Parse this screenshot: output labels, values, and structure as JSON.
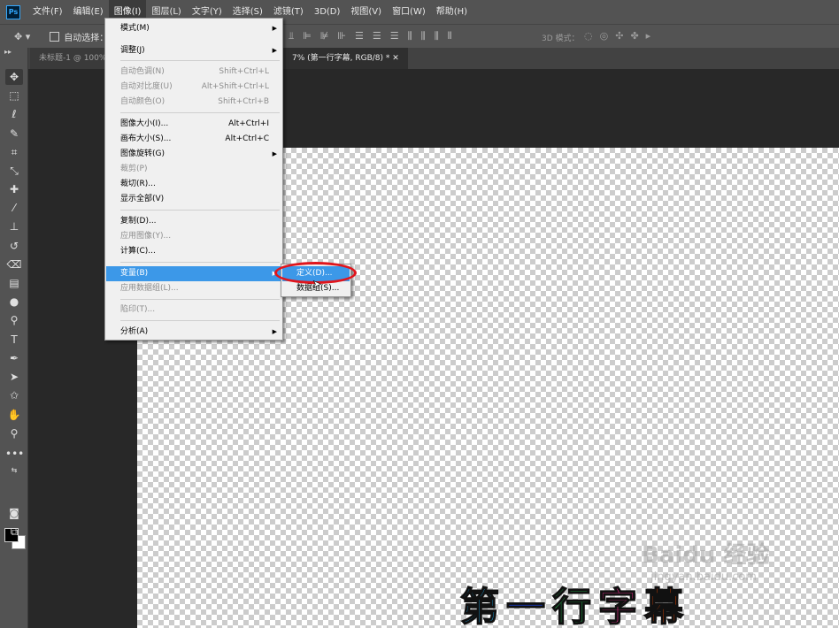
{
  "menubar": {
    "logo": "Ps",
    "items": [
      "文件(F)",
      "编辑(E)",
      "图像(I)",
      "图层(L)",
      "文字(Y)",
      "选择(S)",
      "滤镜(T)",
      "3D(D)",
      "视图(V)",
      "窗口(W)",
      "帮助(H)"
    ],
    "active_index": 2
  },
  "options": {
    "move_icon": "move-icon",
    "auto_select_label": "自动选择：",
    "mode_3d_label": "3D 模式："
  },
  "tabs": [
    {
      "label": "未标题-1 @ 100%"
    },
    {
      "label": "7% (第一行字幕, RGB/8) *"
    }
  ],
  "image_menu": {
    "items": [
      {
        "label": "模式(M)",
        "shortcut": "",
        "submenu": true,
        "disabled": false
      },
      {
        "label": "调整(J)",
        "shortcut": "",
        "submenu": true,
        "disabled": false
      },
      {
        "label": "自动色调(N)",
        "shortcut": "Shift+Ctrl+L",
        "submenu": false,
        "disabled": true
      },
      {
        "label": "自动对比度(U)",
        "shortcut": "Alt+Shift+Ctrl+L",
        "submenu": false,
        "disabled": true
      },
      {
        "label": "自动颜色(O)",
        "shortcut": "Shift+Ctrl+B",
        "submenu": false,
        "disabled": true
      },
      {
        "label": "图像大小(I)...",
        "shortcut": "Alt+Ctrl+I",
        "submenu": false,
        "disabled": false
      },
      {
        "label": "画布大小(S)...",
        "shortcut": "Alt+Ctrl+C",
        "submenu": false,
        "disabled": false
      },
      {
        "label": "图像旋转(G)",
        "shortcut": "",
        "submenu": true,
        "disabled": false
      },
      {
        "label": "裁剪(P)",
        "shortcut": "",
        "submenu": false,
        "disabled": true
      },
      {
        "label": "裁切(R)...",
        "shortcut": "",
        "submenu": false,
        "disabled": false
      },
      {
        "label": "显示全部(V)",
        "shortcut": "",
        "submenu": false,
        "disabled": false
      },
      {
        "label": "复制(D)...",
        "shortcut": "",
        "submenu": false,
        "disabled": false
      },
      {
        "label": "应用图像(Y)...",
        "shortcut": "",
        "submenu": false,
        "disabled": true
      },
      {
        "label": "计算(C)...",
        "shortcut": "",
        "submenu": false,
        "disabled": false
      },
      {
        "label": "变量(B)",
        "shortcut": "",
        "submenu": true,
        "disabled": false,
        "highlighted": true
      },
      {
        "label": "应用数据组(L)...",
        "shortcut": "",
        "submenu": false,
        "disabled": true
      },
      {
        "label": "陷印(T)...",
        "shortcut": "",
        "submenu": false,
        "disabled": true
      },
      {
        "label": "分析(A)",
        "shortcut": "",
        "submenu": true,
        "disabled": false
      }
    ]
  },
  "variables_submenu": {
    "items": [
      {
        "label": "定义(D)...",
        "highlighted": true
      },
      {
        "label": "数据组(S)...",
        "highlighted": false
      }
    ]
  },
  "canvas": {
    "subtitle_chars": [
      "第",
      "一",
      "行",
      "字",
      "幕"
    ],
    "subtitle_colors": [
      "#19a7e6",
      "#1a3fd1",
      "#22b14c",
      "#e62e8b",
      "#ff4d00"
    ],
    "watermark_main": "Baidu 经验",
    "watermark_sub": "jingyan.baidu.com"
  },
  "colors": {
    "highlight": "#3c98e8",
    "annotation_red": "#e0151c"
  }
}
